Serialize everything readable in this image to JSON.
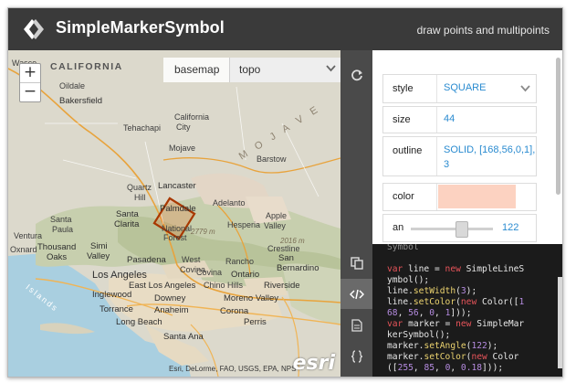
{
  "header": {
    "title": "SimpleMarkerSymbol",
    "subtitle": "draw points and multipoints"
  },
  "map": {
    "zoom_in": "+",
    "zoom_out": "−",
    "basemap_label": "basemap",
    "basemap_value": "topo",
    "attribution": "Esri, DeLorme, FAO, USGS, EPA, NPS",
    "esri_logo": "esri",
    "labels": {
      "california": "CALIFORNIA",
      "wasco": "Wasco",
      "bakersfield": "Bakersfield",
      "oildale": "Oildale",
      "tehachapi": "Tehachapi",
      "california_city": "California",
      "california_city2": "City",
      "mojave": "Mojave",
      "mojave_desert": "M O J A V E",
      "barstow": "Barstow",
      "quartz_hill": "Quartz",
      "quartz_hill2": "Hill",
      "lancaster": "Lancaster",
      "palmdale": "Palmdale",
      "adelanto": "Adelanto",
      "hesperia": "Hesperia",
      "apple_valley": "Apple",
      "apple_valley2": "Valley",
      "santa_clarita": "Santa",
      "santa_clarita2": "Clarita",
      "santa_paula": "Santa",
      "santa_paula2": "Paula",
      "thousand_oaks": "Thousand",
      "thousand_oaks2": "Oaks",
      "simi_valley": "Simi",
      "simi_valley2": "Valley",
      "pasadena": "Pasadena",
      "west_covina": "West",
      "west_covina2": "Covina",
      "rancho": "Rancho",
      "crestline": "Crestline",
      "san_bernardino": "San",
      "san_bernardino2": "Bernardino",
      "los_angeles": "Los Angeles",
      "east_los_angeles": "East Los Angeles",
      "covina": "Covina",
      "ontario": "Ontario",
      "chino_hills": "Chino Hills",
      "riverside": "Riverside",
      "inglewood": "Inglewood",
      "downey": "Downey",
      "torrance": "Torrance",
      "anaheim": "Anaheim",
      "moreno_valley": "Moreno Valley",
      "corona": "Corona",
      "long_beach": "Long Beach",
      "perris": "Perris",
      "santa_ana": "Santa Ana",
      "oxnard": "Oxnard",
      "ventura": "Ventura",
      "angeles_national_forest": "National",
      "angeles_nf2": "Forest",
      "elev_1": "2779 m",
      "elev_2": "2016 m",
      "islands": "Islands"
    }
  },
  "symbol": {
    "outline_color": "#a83800",
    "fill_color": "#ff5500",
    "fill_opacity": 0.18,
    "angle": 122
  },
  "panel": {
    "style_label": "style",
    "style_value": "SQUARE",
    "size_label": "size",
    "size_value": "44",
    "outline_label": "outline",
    "outline_value_1": "SOLID, [168,56,0,1],",
    "outline_value_2": "3",
    "color_label": "color",
    "color_swatch": "#fcd2c1",
    "angle_label": "an",
    "angle_value": "122"
  },
  "code": {
    "lines": [
      "Symbol",
      "",
      "var line = new SimpleLineS",
      "ymbol();",
      "line.setWidth(3);",
      "line.setColor(new Color([1",
      "68, 56, 0, 1]));",
      "var marker = new SimpleMar",
      "kerSymbol();",
      "marker.setAngle(122);",
      "marker.setColor(new Color",
      "([255, 85, 0, 0.18]));"
    ]
  },
  "toolbar": {
    "refresh_icon": "refresh-icon",
    "copy_icon": "copy-icon",
    "code_icon": "code-icon",
    "pdf_icon": "document-icon",
    "json_icon": "json-braces-icon"
  }
}
